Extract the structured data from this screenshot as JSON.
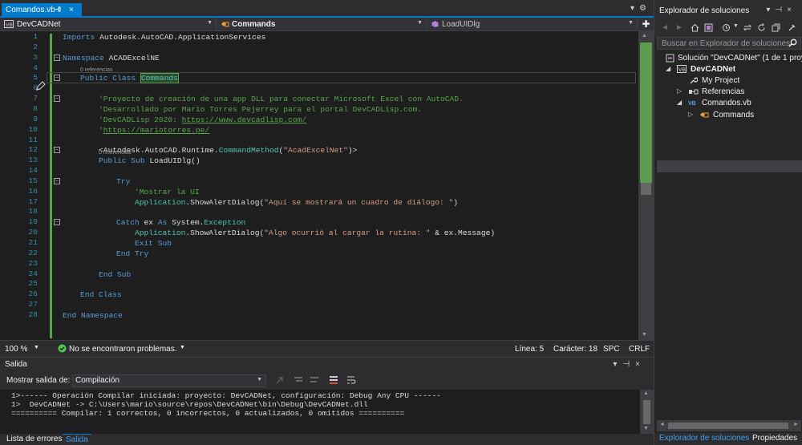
{
  "tab": {
    "file": "Comandos.vb",
    "close": "×"
  },
  "navbar": {
    "project": "DevCADNet",
    "class": "Commands",
    "member": "LoadUIDlg"
  },
  "editor": {
    "line_numbers": [
      "1",
      "2",
      "3",
      "4",
      "5",
      "6",
      "7",
      "8",
      "9",
      "10",
      "11",
      "12",
      "13",
      "14",
      "15",
      "16",
      "17",
      "18",
      "19",
      "20",
      "21",
      "22",
      "23",
      "24",
      "25",
      "26",
      "27",
      "28"
    ],
    "references": "0 referencias",
    "code": {
      "l1_kw": "Imports",
      "l1_rest": " Autodesk.AutoCAD.ApplicationServices",
      "l3_kw": "Namespace",
      "l3_rest": " ACADExcelNE",
      "l5_kw": "Public Class",
      "l5_name": "Commands",
      "l7": "'Proyecto de creación de una app DLL para conectar Microsoft Excel con AutoCAD.",
      "l8": "'Desarrollado por Mario Torres Pejerrey para el portal DevCADLisp.com.",
      "l9_a": "'DevCADLisp 2020: ",
      "l9_link": "https://www.devcadlisp.com/",
      "l10_a": "'",
      "l10_link": "https://mariotorres.pe/",
      "l12_a": "<Autodesk.AutoCAD.Runtime.",
      "l12_ty": "CommandMethod",
      "l12_b": "(",
      "l12_st": "\"AcadExcelNet\"",
      "l12_c": ")>",
      "l13_kw": "Public Sub",
      "l13_rest": " LoadUIDlg()",
      "l15": "Try",
      "l16": "'Mostrar la UI",
      "l17_ty": "Application",
      "l17_a": ".ShowAlertDialog(",
      "l17_st": "\"Aquí se mostrará un cuadro de diálogo: \"",
      "l17_b": ")",
      "l19_kw": "Catch",
      "l19_a": " ex ",
      "l19_kw2": "As",
      "l19_b": " System.",
      "l19_ty": "Exception",
      "l20_ty": "Application",
      "l20_a": ".ShowAlertDialog(",
      "l20_st": "\"Algo ocurrió al cargar la rutina: \"",
      "l20_b": " & ex.Message)",
      "l21": "Exit Sub",
      "l22": "End Try",
      "l24": "End Sub",
      "l26": "End Class",
      "l28": "End Namespace"
    }
  },
  "statusbar": {
    "zoom": "100 %",
    "issues": "No se encontraron problemas.",
    "line": "Línea: 5",
    "col": "Carácter: 18",
    "mode": "SPC",
    "eol": "CRLF"
  },
  "output": {
    "title": "Salida",
    "show_from_label": "Mostrar salida de:",
    "source": "Compilación",
    "lines": [
      "1>------ Operación Compilar iniciada: proyecto: DevCADNet, configuración: Debug Any CPU ------",
      "1>  DevCADNet -> C:\\Users\\mario\\source\\repos\\DevCADNet\\bin\\Debug\\DevCADNet.dll",
      "========== Compilar: 1 correctos, 0 incorrectos, 0 actualizados, 0 omitidos =========="
    ]
  },
  "bottom_tabs": [
    "Lista de errores",
    "Salida"
  ],
  "solution_explorer": {
    "title": "Explorador de soluciones",
    "search_placeholder": "Buscar en Explorador de soluciones",
    "tree": [
      {
        "label": "Solución \"DevCADNet\" (1 de 1 proy",
        "icon": "solution-icon"
      },
      {
        "label": "DevCADNet",
        "icon": "vb-project-icon"
      },
      {
        "label": "My Project",
        "icon": "wrench-icon"
      },
      {
        "label": "Referencias",
        "icon": "references-icon"
      },
      {
        "label": "Comandos.vb",
        "icon": "vb-file-icon"
      },
      {
        "label": "Commands",
        "icon": "class-icon"
      }
    ],
    "tabs": [
      "Explorador de soluciones",
      "Propiedades"
    ]
  },
  "colors": {
    "accent": "#007acc",
    "keyword": "#569cd6",
    "comment": "#57a64a",
    "type": "#4ec9b0",
    "string": "#d69d85",
    "line_number": "#2b91af"
  }
}
